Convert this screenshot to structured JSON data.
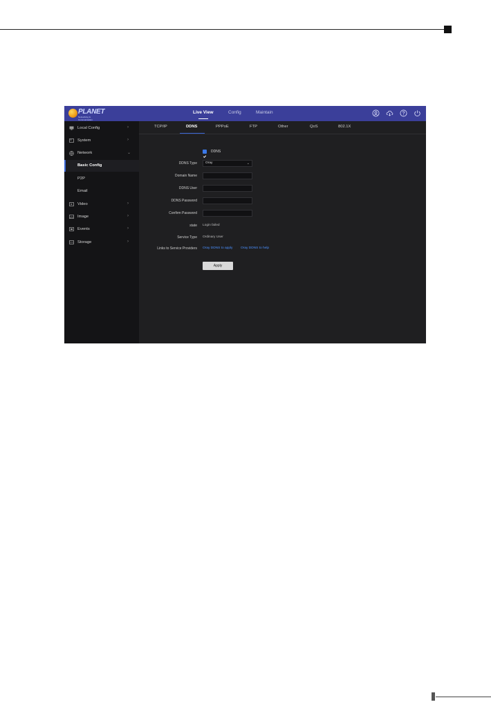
{
  "topbar": {
    "logo_text": "PLANET",
    "logo_sub": "Networking & Communication",
    "nav": [
      {
        "label": "Live View",
        "active": true
      },
      {
        "label": "Config",
        "active": false
      },
      {
        "label": "Maintain",
        "active": false
      }
    ]
  },
  "sidebar": {
    "items": [
      {
        "label": "Local Config",
        "icon": "monitor-icon",
        "chevron": "›"
      },
      {
        "label": "System",
        "icon": "system-icon",
        "chevron": "›"
      },
      {
        "label": "Network",
        "icon": "globe-icon",
        "chevron": "⌄"
      },
      {
        "label": "Basic Config"
      },
      {
        "label": "P2P"
      },
      {
        "label": "Email"
      },
      {
        "label": "Video",
        "icon": "video-icon",
        "chevron": "›"
      },
      {
        "label": "Image",
        "icon": "image-icon",
        "chevron": "›"
      },
      {
        "label": "Events",
        "icon": "events-icon",
        "chevron": "›"
      },
      {
        "label": "Storage",
        "icon": "storage-icon",
        "chevron": "›"
      }
    ],
    "selected": "Basic Config"
  },
  "tabs": [
    {
      "label": "TCP/IP"
    },
    {
      "label": "DDNS",
      "active": true
    },
    {
      "label": "PPPoE"
    },
    {
      "label": "FTP"
    },
    {
      "label": "Other"
    },
    {
      "label": "QoS"
    },
    {
      "label": "802.1X"
    }
  ],
  "form": {
    "ddns_checkbox_label": "DDNS",
    "ddns_checked": true,
    "ddns_type_label": "DDNS Type",
    "ddns_type_value": "Oray",
    "domain_name_label": "Domain Name",
    "ddns_user_label": "DDNS User",
    "ddns_password_label": "DDNS Password",
    "confirm_password_label": "Confirm Password",
    "state_label": "state",
    "state_value": "Login failed",
    "service_type_label": "Service Type",
    "service_type_value": "Ordinary User",
    "links_label": "Links to Service Providers",
    "link_apply": "Oray DDNS to apply",
    "link_help": "Oray DDNS to help",
    "apply_button": "Apply"
  },
  "colors": {
    "topbar": "#3b3f9a",
    "accent": "#3b68d8",
    "link": "#4a90ff",
    "panel_bg": "#1f1f21",
    "sidebar_bg": "#141416"
  }
}
